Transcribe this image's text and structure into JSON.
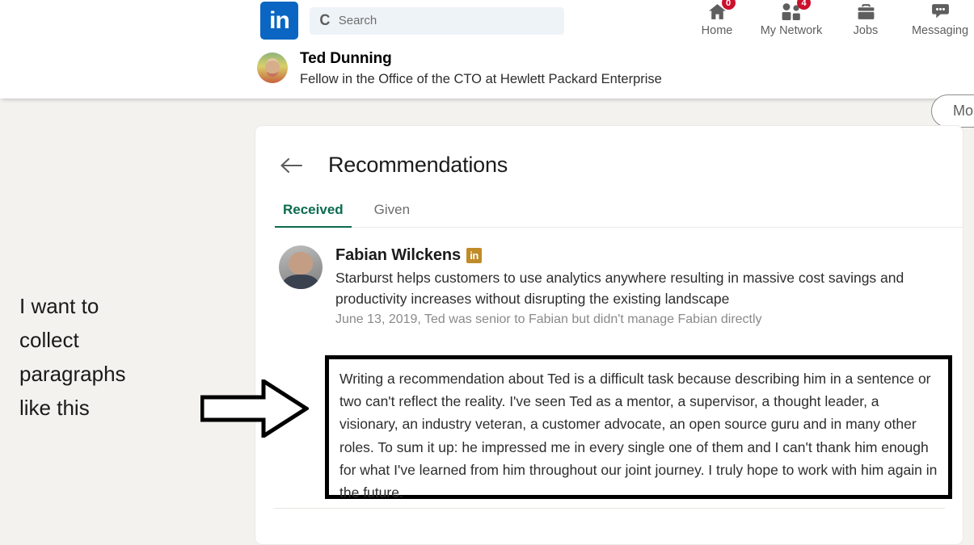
{
  "topnav": {
    "logo_alt": "LinkedIn",
    "logo_text": "in",
    "search": {
      "placeholder": "Search",
      "value": "",
      "icon": "search-icon"
    },
    "items": [
      {
        "label": "Home",
        "icon": "home-icon",
        "badge": "0"
      },
      {
        "label": "My Network",
        "icon": "my-network-icon",
        "badge": "4"
      },
      {
        "label": "Jobs",
        "icon": "briefcase-icon",
        "badge": ""
      },
      {
        "label": "Messaging",
        "icon": "message-bubble-icon",
        "badge": ""
      }
    ]
  },
  "subheader": {
    "name": "Ted Dunning",
    "headline": "Fellow in the Office of the CTO at Hewlett Packard Enterprise",
    "more_label": "More",
    "avatar": "profile-photo-ted-dunning"
  },
  "card": {
    "back_icon": "back-arrow-icon",
    "title": "Recommendations",
    "tabs": [
      {
        "label": "Received",
        "active": true
      },
      {
        "label": "Given",
        "active": false
      }
    ],
    "recommendation": {
      "avatar": "profile-photo-fabian-wilckens",
      "name": "Fabian Wilckens",
      "premium_badge": "in",
      "headline": "Starburst helps customers to use analytics anywhere resulting in massive cost savings and productivity increases without disrupting the existing landscape",
      "meta": "June 13, 2019, Ted was senior to Fabian but didn't manage Fabian directly",
      "text": "Writing a recommendation about Ted is a difficult task because describing him in a sentence or two can't reflect the reality. I've seen Ted as a mentor, a supervisor, a thought leader, a visionary, an industry veteran, a customer advocate, an open source guru and in many other roles. To sum it up: he impressed me in every single one of them and I can't thank him enough for what I've learned from him throughout our joint journey. I truly hope to work with him again in the future."
    }
  },
  "annotation": {
    "text": "I want to\ncollect\nparagraphs\nlike this",
    "arrow": "right-arrow-annotation-icon"
  },
  "colors": {
    "brand_blue": "#0A66C2",
    "badge_red": "#CB112D",
    "tab_active_green": "#0A6B4E",
    "premium_gold": "#C08B28",
    "page_background": "#F3F2EF",
    "highlight_border": "#000000"
  }
}
